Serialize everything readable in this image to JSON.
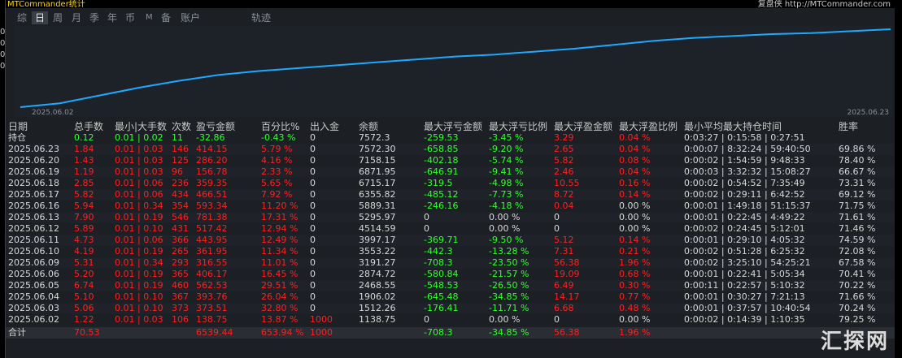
{
  "window": {
    "title": "MTCommander统计",
    "right_text": "复盘侠 http://MTCommander.com"
  },
  "tabs": [
    "综",
    "日",
    "周",
    "月",
    "季",
    "年",
    "币",
    "M",
    "备",
    "账户",
    "轨迹"
  ],
  "active_tab": "日",
  "chart": {
    "start_date": "2025.06.02",
    "end_date": "2025.06.23",
    "line_color": "#1ea9ff",
    "equity": [
      0,
      4,
      12,
      20,
      27,
      33,
      37,
      40,
      43,
      46,
      49,
      52,
      54,
      57,
      60,
      64,
      68,
      71,
      73,
      75,
      76,
      78,
      80
    ]
  },
  "left_axis": [
    "0",
    "0",
    "0",
    "0",
    "0"
  ],
  "headers": {
    "date": "日期",
    "total_lots": "总手数",
    "minmax_lots": "最小|大手数",
    "count": "次数",
    "pnl": "盈亏金额",
    "pct": "百分比%",
    "inout": "出入金",
    "balance": "余额",
    "max_float_loss": "最大浮亏金额",
    "max_float_loss_pct": "最大浮亏比例",
    "max_float_profit": "最大浮盈金额",
    "max_float_profit_pct": "最大浮盈比例",
    "hold_time": "最小平均最大持仓时间",
    "winrate": "胜率"
  },
  "holding": {
    "date": "持仓",
    "total_lots": "0.12",
    "minmax_lots": "0.01 | 0.02",
    "count": "11",
    "pnl": "-32.86",
    "pct": "-0.43 %",
    "inout": "0",
    "balance": "7572.3",
    "max_float_loss": "-259.53",
    "max_float_loss_pct": "-3.45 %",
    "max_float_profit": "3.29",
    "max_float_profit_pct": "0.04 %",
    "hold_time": "0:03:27 | 0:15:58 | 0:27:51",
    "winrate": ""
  },
  "rows": [
    {
      "date": "2025.06.23",
      "total_lots": "1.84",
      "minmax_lots": "0.01 | 0.03",
      "count": "146",
      "pnl": "414.15",
      "pct": "5.79 %",
      "inout": "0",
      "balance": "7572.30",
      "max_float_loss": "-658.85",
      "max_float_loss_pct": "-9.20 %",
      "max_float_profit": "2.65",
      "max_float_profit_pct": "0.04 %",
      "hold_time": "0:00:07 | 8:32:24 | 59:40:50",
      "winrate": "69.86 %"
    },
    {
      "date": "2025.06.20",
      "total_lots": "1.43",
      "minmax_lots": "0.01 | 0.03",
      "count": "125",
      "pnl": "286.20",
      "pct": "4.16 %",
      "inout": "0",
      "balance": "7158.15",
      "max_float_loss": "-402.18",
      "max_float_loss_pct": "-5.74 %",
      "max_float_profit": "5.82",
      "max_float_profit_pct": "0.08 %",
      "hold_time": "0:00:02 | 1:54:59 | 9:48:33",
      "winrate": "78.40 %"
    },
    {
      "date": "2025.06.19",
      "total_lots": "1.19",
      "minmax_lots": "0.01 | 0.03",
      "count": "96",
      "pnl": "156.78",
      "pct": "2.33 %",
      "inout": "0",
      "balance": "6871.95",
      "max_float_loss": "-646.91",
      "max_float_loss_pct": "-9.41 %",
      "max_float_profit": "2.46",
      "max_float_profit_pct": "0.04 %",
      "hold_time": "0:00:03 | 3:32:32 | 15:08:27",
      "winrate": "66.67 %"
    },
    {
      "date": "2025.06.18",
      "total_lots": "2.85",
      "minmax_lots": "0.01 | 0.06",
      "count": "236",
      "pnl": "359.35",
      "pct": "5.65 %",
      "inout": "0",
      "balance": "6715.17",
      "max_float_loss": "-319.5",
      "max_float_loss_pct": "-4.98 %",
      "max_float_profit": "10.55",
      "max_float_profit_pct": "0.16 %",
      "hold_time": "0:00:02 | 0:54:52 | 7:35:49",
      "winrate": "73.31 %"
    },
    {
      "date": "2025.06.17",
      "total_lots": "5.82",
      "minmax_lots": "0.01 | 0.06",
      "count": "434",
      "pnl": "466.51",
      "pct": "7.92 %",
      "inout": "0",
      "balance": "6355.82",
      "max_float_loss": "-485.12",
      "max_float_loss_pct": "-7.73 %",
      "max_float_profit": "8.72",
      "max_float_profit_pct": "0.14 %",
      "hold_time": "0:00:02 | 0:29:11 | 6:42:52",
      "winrate": "69.12 %"
    },
    {
      "date": "2025.06.16",
      "total_lots": "5.94",
      "minmax_lots": "0.01 | 0.34",
      "count": "354",
      "pnl": "593.34",
      "pct": "11.20 %",
      "inout": "0",
      "balance": "5889.31",
      "max_float_loss": "-246.16",
      "max_float_loss_pct": "-4.18 %",
      "max_float_profit": "0.04",
      "max_float_profit_pct": "0.00 %",
      "hold_time": "0:00:01 | 1:49:18 | 51:15:37",
      "winrate": "71.75 %"
    },
    {
      "date": "2025.06.13",
      "total_lots": "7.90",
      "minmax_lots": "0.01 | 0.19",
      "count": "546",
      "pnl": "781.38",
      "pct": "17.31 %",
      "inout": "0",
      "balance": "5295.97",
      "max_float_loss": "0",
      "max_float_loss_pct": "0.00 %",
      "max_float_profit": "0",
      "max_float_profit_pct": "0.00 %",
      "hold_time": "0:00:01 | 0:22:45 | 4:49:22",
      "winrate": "71.61 %"
    },
    {
      "date": "2025.06.12",
      "total_lots": "5.89",
      "minmax_lots": "0.01 | 0.10",
      "count": "431",
      "pnl": "517.42",
      "pct": "12.94 %",
      "inout": "0",
      "balance": "4514.59",
      "max_float_loss": "0",
      "max_float_loss_pct": "0.00 %",
      "max_float_profit": "0",
      "max_float_profit_pct": "0.00 %",
      "hold_time": "0:00:02 | 0:24:45 | 5:12:01",
      "winrate": "71.46 %"
    },
    {
      "date": "2025.06.11",
      "total_lots": "4.73",
      "minmax_lots": "0.01 | 0.06",
      "count": "366",
      "pnl": "443.95",
      "pct": "12.49 %",
      "inout": "0",
      "balance": "3997.17",
      "max_float_loss": "-369.71",
      "max_float_loss_pct": "-9.50 %",
      "max_float_profit": "5.12",
      "max_float_profit_pct": "0.14 %",
      "hold_time": "0:00:01 | 0:29:10 | 4:05:32",
      "winrate": "74.59 %"
    },
    {
      "date": "2025.06.10",
      "total_lots": "4.19",
      "minmax_lots": "0.01 | 0.19",
      "count": "265",
      "pnl": "361.95",
      "pct": "11.34 %",
      "inout": "0",
      "balance": "3553.22",
      "max_float_loss": "-442.3",
      "max_float_loss_pct": "-13.28 %",
      "max_float_profit": "7.31",
      "max_float_profit_pct": "0.21 %",
      "hold_time": "0:00:02 | 0:51:28 | 6:25:32",
      "winrate": "72.08 %"
    },
    {
      "date": "2025.06.09",
      "total_lots": "5.31",
      "minmax_lots": "0.01 | 0.34",
      "count": "293",
      "pnl": "316.55",
      "pct": "11.01 %",
      "inout": "0",
      "balance": "3191.27",
      "max_float_loss": "-708.3",
      "max_float_loss_pct": "-23.50 %",
      "max_float_profit": "56.38",
      "max_float_profit_pct": "1.96 %",
      "hold_time": "0:00:02 | 3:25:10 | 54:25:21",
      "winrate": "67.58 %"
    },
    {
      "date": "2025.06.06",
      "total_lots": "5.20",
      "minmax_lots": "0.01 | 0.19",
      "count": "365",
      "pnl": "406.17",
      "pct": "16.45 %",
      "inout": "0",
      "balance": "2874.72",
      "max_float_loss": "-580.84",
      "max_float_loss_pct": "-21.57 %",
      "max_float_profit": "19.09",
      "max_float_profit_pct": "0.68 %",
      "hold_time": "0:00:01 | 0:22:41 | 5:05:34",
      "winrate": "70.41 %"
    },
    {
      "date": "2025.06.05",
      "total_lots": "6.74",
      "minmax_lots": "0.01 | 0.19",
      "count": "460",
      "pnl": "562.53",
      "pct": "29.51 %",
      "inout": "0",
      "balance": "2468.55",
      "max_float_loss": "-548.53",
      "max_float_loss_pct": "-26.50 %",
      "max_float_profit": "6.49",
      "max_float_profit_pct": "0.30 %",
      "hold_time": "0:00:11 | 0:22:57 | 5:10:32",
      "winrate": "70.22 %"
    },
    {
      "date": "2025.06.04",
      "total_lots": "5.10",
      "minmax_lots": "0.01 | 0.10",
      "count": "367",
      "pnl": "393.76",
      "pct": "26.04 %",
      "inout": "0",
      "balance": "1906.02",
      "max_float_loss": "-645.48",
      "max_float_loss_pct": "-34.85 %",
      "max_float_profit": "14.17",
      "max_float_profit_pct": "0.77 %",
      "hold_time": "0:00:01 | 0:30:27 | 7:21:13",
      "winrate": "71.66 %"
    },
    {
      "date": "2025.06.03",
      "total_lots": "5.06",
      "minmax_lots": "0.01 | 0.10",
      "count": "373",
      "pnl": "373.51",
      "pct": "32.80 %",
      "inout": "0",
      "balance": "1512.26",
      "max_float_loss": "-176.41",
      "max_float_loss_pct": "-11.71 %",
      "max_float_profit": "6.68",
      "max_float_profit_pct": "0.48 %",
      "hold_time": "0:00:01 | 0:37:57 | 10:40:54",
      "winrate": "70.24 %"
    },
    {
      "date": "2025.06.02",
      "total_lots": "1.22",
      "minmax_lots": "0.01 | 0.03",
      "count": "106",
      "pnl": "138.75",
      "pct": "13.87 %",
      "inout": "1000",
      "balance": "1138.75",
      "max_float_loss": "0",
      "max_float_loss_pct": "0.00 %",
      "max_float_profit": "0",
      "max_float_profit_pct": "0.00 %",
      "hold_time": "0:00:02 | 0:14:39 | 1:10:35",
      "winrate": "79.25 %"
    }
  ],
  "total": {
    "date": "合计",
    "total_lots": "70.53",
    "minmax_lots": "",
    "count": "",
    "pnl": "6539.44",
    "pct": "653.94 %",
    "inout": "1000",
    "balance": "",
    "max_float_loss": "-708.3",
    "max_float_loss_pct": "-34.85 %",
    "max_float_profit": "56.38",
    "max_float_profit_pct": "1.96 %",
    "hold_time": "",
    "winrate": ""
  },
  "watermark": "汇探网"
}
